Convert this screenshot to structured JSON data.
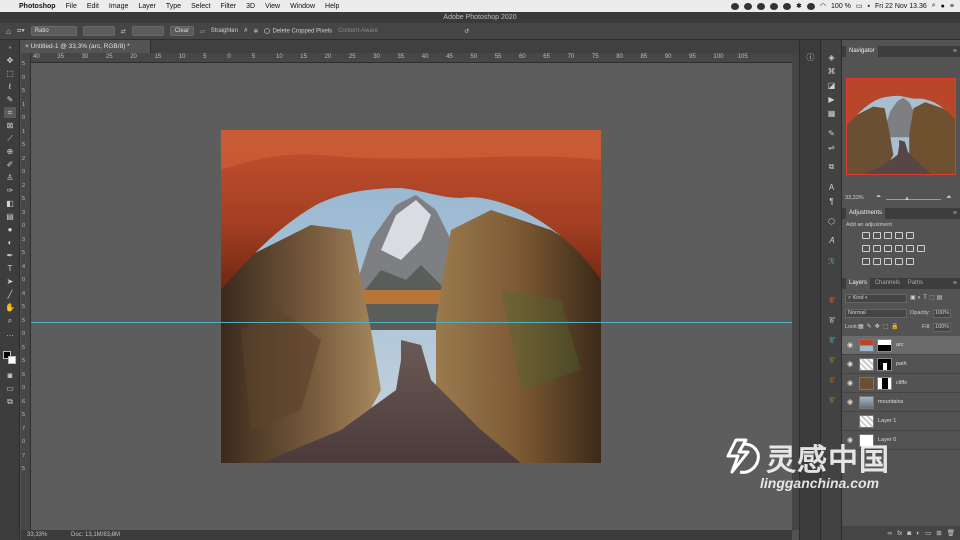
{
  "menubar": {
    "app_name": "Photoshop",
    "items": [
      "File",
      "Edit",
      "Image",
      "Layer",
      "Type",
      "Select",
      "Filter",
      "3D",
      "View",
      "Window",
      "Help"
    ],
    "battery": "100 %",
    "datetime": "Fri 22 Nov  13.36"
  },
  "window": {
    "title": "Adobe Photoshop 2020"
  },
  "options": {
    "ratio_label": "Ratio",
    "clear_label": "Clear",
    "straighten_label": "Straighten",
    "delete_cropped_label": "Delete Cropped Pixels",
    "content_aware_label": "Content-Aware"
  },
  "document": {
    "tab_title": "Untitled-1 @ 33,3% (arc, RGB/8) *",
    "zoom": "33,33%",
    "doc_size": "Doc: 13,1M/83,9M"
  },
  "ruler": {
    "h_labels": [
      "40",
      "35",
      "30",
      "25",
      "20",
      "15",
      "10",
      "5",
      "0",
      "5",
      "10",
      "15",
      "20",
      "25",
      "30",
      "35",
      "40",
      "45",
      "50",
      "55",
      "60",
      "65",
      "70",
      "75",
      "80",
      "85",
      "90",
      "95",
      "100",
      "105"
    ],
    "v_labels": [
      "5",
      "0",
      "5",
      "1",
      "0",
      "1",
      "5",
      "2",
      "0",
      "2",
      "5",
      "3",
      "0",
      "3",
      "5",
      "4",
      "0",
      "4",
      "5",
      "5",
      "0",
      "5",
      "5",
      "6",
      "0",
      "6",
      "5",
      "7",
      "0",
      "7",
      "5"
    ]
  },
  "navigator": {
    "title": "Navigator",
    "zoom": "33,33%"
  },
  "adjustments": {
    "title": "Adjustments",
    "subtitle": "Add an adjustment"
  },
  "layers_panel": {
    "tabs": [
      "Layers",
      "Channels",
      "Paths"
    ],
    "kind_label": "Kind",
    "blend_mode": "Normal",
    "opacity_label": "Opacity:",
    "opacity_value": "100%",
    "lock_label": "Lock:",
    "fill_label": "Fill:",
    "fill_value": "100%",
    "layers": [
      {
        "name": "arc",
        "selected": true,
        "has_mask": true
      },
      {
        "name": "path",
        "selected": false,
        "has_mask": true
      },
      {
        "name": "cliffs",
        "selected": false,
        "has_mask": true
      },
      {
        "name": "mountains",
        "selected": false,
        "has_mask": false
      },
      {
        "name": "Layer 1",
        "selected": false,
        "has_mask": false
      },
      {
        "name": "Layer 0",
        "selected": false,
        "has_mask": false
      }
    ]
  },
  "watermark": {
    "cn_text": "灵感中国",
    "url_text": "lingganchina.com"
  },
  "colors": {
    "guide": "#4fb0c6",
    "nav_frame": "#e03a2c",
    "arch": "#b8472a",
    "sky": "#a9bfd1"
  }
}
